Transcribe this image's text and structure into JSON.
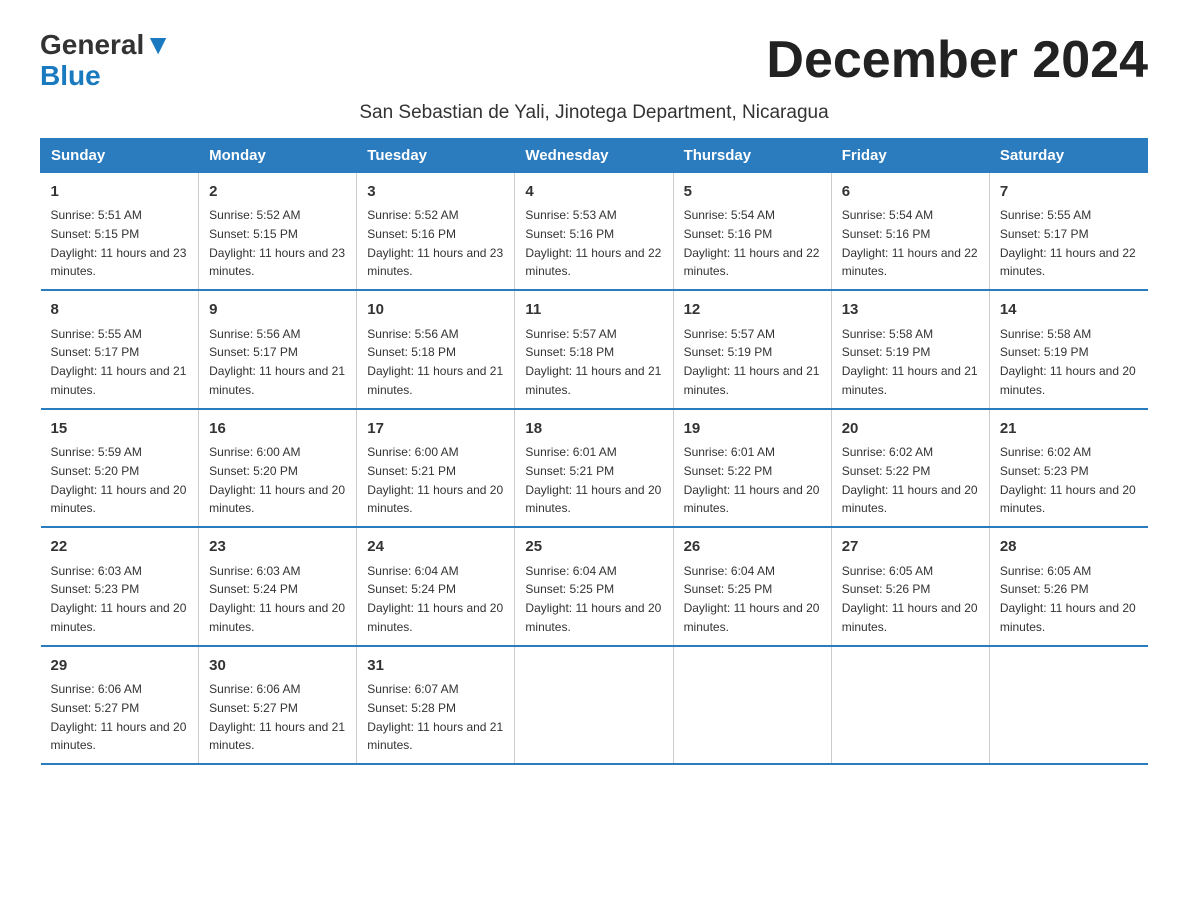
{
  "header": {
    "logo_general": "General",
    "logo_blue": "Blue",
    "month_title": "December 2024",
    "subtitle": "San Sebastian de Yali, Jinotega Department, Nicaragua"
  },
  "weekdays": [
    "Sunday",
    "Monday",
    "Tuesday",
    "Wednesday",
    "Thursday",
    "Friday",
    "Saturday"
  ],
  "weeks": [
    [
      {
        "day": "1",
        "sunrise": "5:51 AM",
        "sunset": "5:15 PM",
        "daylight": "11 hours and 23 minutes."
      },
      {
        "day": "2",
        "sunrise": "5:52 AM",
        "sunset": "5:15 PM",
        "daylight": "11 hours and 23 minutes."
      },
      {
        "day": "3",
        "sunrise": "5:52 AM",
        "sunset": "5:16 PM",
        "daylight": "11 hours and 23 minutes."
      },
      {
        "day": "4",
        "sunrise": "5:53 AM",
        "sunset": "5:16 PM",
        "daylight": "11 hours and 22 minutes."
      },
      {
        "day": "5",
        "sunrise": "5:54 AM",
        "sunset": "5:16 PM",
        "daylight": "11 hours and 22 minutes."
      },
      {
        "day": "6",
        "sunrise": "5:54 AM",
        "sunset": "5:16 PM",
        "daylight": "11 hours and 22 minutes."
      },
      {
        "day": "7",
        "sunrise": "5:55 AM",
        "sunset": "5:17 PM",
        "daylight": "11 hours and 22 minutes."
      }
    ],
    [
      {
        "day": "8",
        "sunrise": "5:55 AM",
        "sunset": "5:17 PM",
        "daylight": "11 hours and 21 minutes."
      },
      {
        "day": "9",
        "sunrise": "5:56 AM",
        "sunset": "5:17 PM",
        "daylight": "11 hours and 21 minutes."
      },
      {
        "day": "10",
        "sunrise": "5:56 AM",
        "sunset": "5:18 PM",
        "daylight": "11 hours and 21 minutes."
      },
      {
        "day": "11",
        "sunrise": "5:57 AM",
        "sunset": "5:18 PM",
        "daylight": "11 hours and 21 minutes."
      },
      {
        "day": "12",
        "sunrise": "5:57 AM",
        "sunset": "5:19 PM",
        "daylight": "11 hours and 21 minutes."
      },
      {
        "day": "13",
        "sunrise": "5:58 AM",
        "sunset": "5:19 PM",
        "daylight": "11 hours and 21 minutes."
      },
      {
        "day": "14",
        "sunrise": "5:58 AM",
        "sunset": "5:19 PM",
        "daylight": "11 hours and 20 minutes."
      }
    ],
    [
      {
        "day": "15",
        "sunrise": "5:59 AM",
        "sunset": "5:20 PM",
        "daylight": "11 hours and 20 minutes."
      },
      {
        "day": "16",
        "sunrise": "6:00 AM",
        "sunset": "5:20 PM",
        "daylight": "11 hours and 20 minutes."
      },
      {
        "day": "17",
        "sunrise": "6:00 AM",
        "sunset": "5:21 PM",
        "daylight": "11 hours and 20 minutes."
      },
      {
        "day": "18",
        "sunrise": "6:01 AM",
        "sunset": "5:21 PM",
        "daylight": "11 hours and 20 minutes."
      },
      {
        "day": "19",
        "sunrise": "6:01 AM",
        "sunset": "5:22 PM",
        "daylight": "11 hours and 20 minutes."
      },
      {
        "day": "20",
        "sunrise": "6:02 AM",
        "sunset": "5:22 PM",
        "daylight": "11 hours and 20 minutes."
      },
      {
        "day": "21",
        "sunrise": "6:02 AM",
        "sunset": "5:23 PM",
        "daylight": "11 hours and 20 minutes."
      }
    ],
    [
      {
        "day": "22",
        "sunrise": "6:03 AM",
        "sunset": "5:23 PM",
        "daylight": "11 hours and 20 minutes."
      },
      {
        "day": "23",
        "sunrise": "6:03 AM",
        "sunset": "5:24 PM",
        "daylight": "11 hours and 20 minutes."
      },
      {
        "day": "24",
        "sunrise": "6:04 AM",
        "sunset": "5:24 PM",
        "daylight": "11 hours and 20 minutes."
      },
      {
        "day": "25",
        "sunrise": "6:04 AM",
        "sunset": "5:25 PM",
        "daylight": "11 hours and 20 minutes."
      },
      {
        "day": "26",
        "sunrise": "6:04 AM",
        "sunset": "5:25 PM",
        "daylight": "11 hours and 20 minutes."
      },
      {
        "day": "27",
        "sunrise": "6:05 AM",
        "sunset": "5:26 PM",
        "daylight": "11 hours and 20 minutes."
      },
      {
        "day": "28",
        "sunrise": "6:05 AM",
        "sunset": "5:26 PM",
        "daylight": "11 hours and 20 minutes."
      }
    ],
    [
      {
        "day": "29",
        "sunrise": "6:06 AM",
        "sunset": "5:27 PM",
        "daylight": "11 hours and 20 minutes."
      },
      {
        "day": "30",
        "sunrise": "6:06 AM",
        "sunset": "5:27 PM",
        "daylight": "11 hours and 21 minutes."
      },
      {
        "day": "31",
        "sunrise": "6:07 AM",
        "sunset": "5:28 PM",
        "daylight": "11 hours and 21 minutes."
      },
      null,
      null,
      null,
      null
    ]
  ]
}
